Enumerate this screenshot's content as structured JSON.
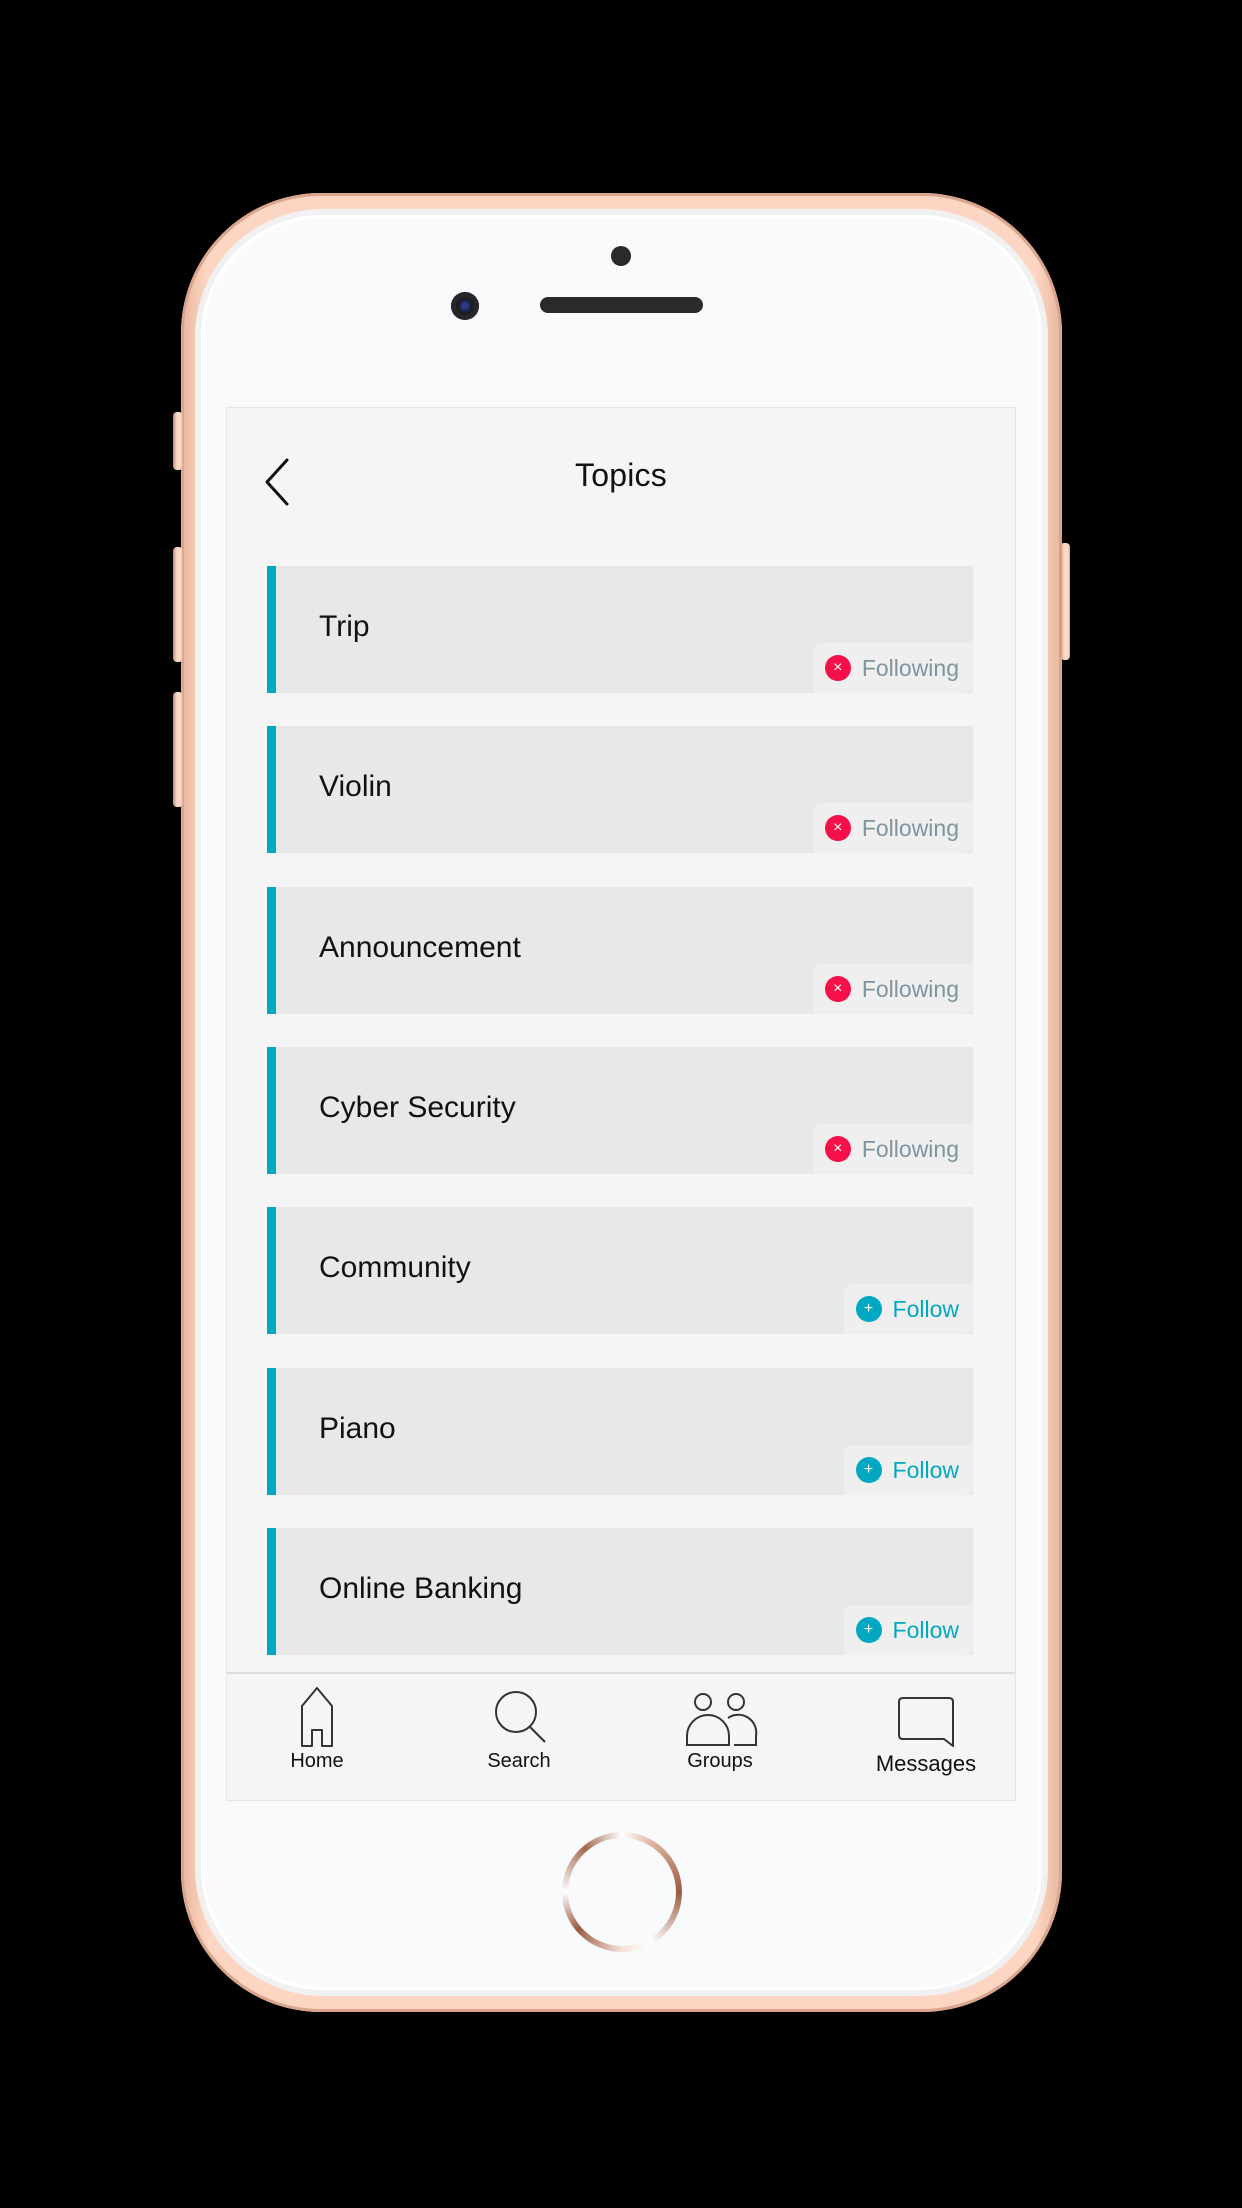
{
  "header": {
    "title": "Topics",
    "back_icon": "chevron-left-icon"
  },
  "topics": [
    {
      "name": "Trip",
      "status": "following",
      "action_label": "Following",
      "action_icon": "close-circle-icon",
      "icon_glyph": "×"
    },
    {
      "name": "Violin",
      "status": "following",
      "action_label": "Following",
      "action_icon": "close-circle-icon",
      "icon_glyph": "×"
    },
    {
      "name": "Announcement",
      "status": "following",
      "action_label": "Following",
      "action_icon": "close-circle-icon",
      "icon_glyph": "×"
    },
    {
      "name": "Cyber Security",
      "status": "following",
      "action_label": "Following",
      "action_icon": "close-circle-icon",
      "icon_glyph": "×"
    },
    {
      "name": "Community",
      "status": "follow",
      "action_label": "Follow",
      "action_icon": "plus-circle-icon",
      "icon_glyph": "+"
    },
    {
      "name": "Piano",
      "status": "follow",
      "action_label": "Follow",
      "action_icon": "plus-circle-icon",
      "icon_glyph": "+"
    },
    {
      "name": "Online Banking",
      "status": "follow",
      "action_label": "Follow",
      "action_icon": "plus-circle-icon",
      "icon_glyph": "+"
    }
  ],
  "nav": {
    "items": [
      {
        "label": "Home",
        "icon": "home-icon"
      },
      {
        "label": "Search",
        "icon": "search-icon"
      },
      {
        "label": "Groups",
        "icon": "groups-icon"
      },
      {
        "label": "Messages",
        "icon": "message-icon"
      }
    ]
  },
  "colors": {
    "accent": "#00a8c2",
    "unfollow_red": "#f5104a",
    "following_text": "#7f949f",
    "card_bg": "#e8e8e8",
    "screen_bg": "#f5f5f5",
    "frame": "#fcd6c2"
  }
}
